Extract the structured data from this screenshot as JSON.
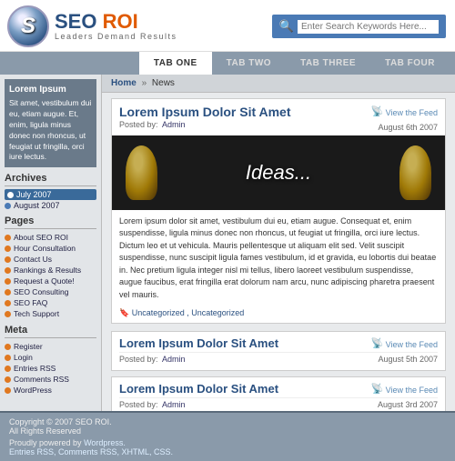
{
  "header": {
    "logo_s": "S",
    "logo_name": "SEO",
    "logo_roi": " ROI",
    "tagline": "Leaders  Demand  Results",
    "search_placeholder": "Enter Search Keywords Here..."
  },
  "nav": {
    "tabs": [
      {
        "label": "TAB ONE",
        "active": true
      },
      {
        "label": "TAB TWO",
        "active": false
      },
      {
        "label": "TAB THREE",
        "active": false
      },
      {
        "label": "TAB FOUR",
        "active": false
      }
    ]
  },
  "sidebar": {
    "promo_title": "Lorem Ipsum",
    "promo_text": "Sit amet, vestibulum dui eu, etiam augue. Et, enim, ligula minus donec non rhoncus, ut feugiat ut fringilla, orci iure lectus.",
    "archives_title": "Archives",
    "archives": [
      {
        "label": "July 2007",
        "active": true
      },
      {
        "label": "August 2007",
        "active": false
      }
    ],
    "pages_title": "Pages",
    "pages": [
      {
        "label": "About SEO ROI"
      },
      {
        "label": "Hour Consultation"
      },
      {
        "label": "Contact Us"
      },
      {
        "label": "Rankings & Results"
      },
      {
        "label": "Request a Quote!"
      },
      {
        "label": "SEO Consulting"
      },
      {
        "label": "SEO FAQ"
      },
      {
        "label": "Tech Support"
      }
    ],
    "meta_title": "Meta",
    "meta": [
      {
        "label": "Register"
      },
      {
        "label": "Login"
      },
      {
        "label": "Entries RSS"
      },
      {
        "label": "Comments RSS"
      },
      {
        "label": "WordPress"
      }
    ]
  },
  "breadcrumb": {
    "home": "Home",
    "sep": "»",
    "current": "News"
  },
  "articles": [
    {
      "id": "main",
      "title": "Lorem Ipsum Dolor Sit Amet",
      "posted_by": "Posted by:",
      "author": "Admin",
      "feed_label": "View the Feed",
      "date": "August 6th 2007",
      "featured_text": "Ideas...",
      "body": "Lorem ipsum dolor sit amet, vestibulum dui eu, etiam augue. Consequat et, enim suspendisse, ligula minus donec non rhoncus, ut feugiat ut fringilla, orci iure lectus. Dictum leo et ut vehicula. Mauris pellentesque ut aliquam elit sed. Velit suscipit suspendisse, nunc suscipit ligula fames vestibulum, id et gravida, eu lobortis dui beatae in. Nec pretium ligula integer nisl mi tellus, libero laoreet vestibulum suspendisse, augue faucibus, erat fringilla erat dolorum nam arcu, nunc adipiscing pharetra praesent vel mauris.",
      "tags": "Uncategorized , Uncategorized"
    },
    {
      "id": "second",
      "title": "Lorem Ipsum Dolor Sit Amet",
      "posted_by": "Posted by:",
      "author": "Admin",
      "feed_label": "View the Feed",
      "date": "August 5th 2007"
    },
    {
      "id": "third",
      "title": "Lorem Ipsum Dolor Sit Amet",
      "posted_by": "Posted by:",
      "author": "Admin",
      "feed_label": "View the Feed",
      "date": "August 3rd 2007"
    }
  ],
  "footer": {
    "copyright": "Copyright © 2007 SEO ROI.",
    "rights": "All Rights Reserved",
    "powered_by": "Proudly powered by",
    "wordpress": "Wordpress.",
    "links": "Entries RSS, Comments RSS, XHTML, CSS."
  }
}
